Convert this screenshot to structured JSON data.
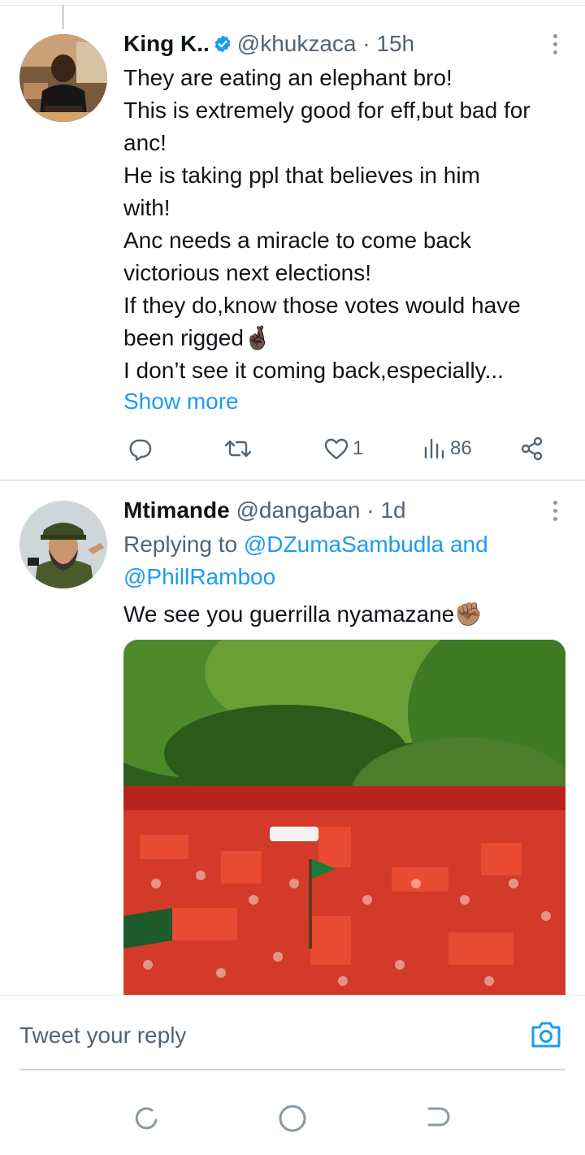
{
  "tweets": [
    {
      "name": "King K..",
      "handle": "@khukzaca",
      "separator": "·",
      "time": "15h",
      "verified": true,
      "lines": [
        "They are eating an elephant bro!",
        "This is extremely good for eff,but bad for",
        "anc!",
        "He is taking ppl that believes in him",
        "with!",
        "Anc needs a miracle to come back",
        "victorious next elections!",
        "If they do,know those votes would have",
        "been rigged🤞🏿",
        "I don’t see it coming back,especially..."
      ],
      "show_more": "Show more",
      "likes": "1",
      "views": "86"
    },
    {
      "name": "Mtimande",
      "handle": "@dangaban",
      "separator": "·",
      "time": "1d",
      "replying_prefix": "Replying to",
      "reply_mention_1": "@DZumaSambudla",
      "reply_and": "and",
      "reply_mention_2": "@PhillRamboo",
      "text": "We see you guerrilla nyamazane✊🏽"
    }
  ],
  "composer": {
    "placeholder": "Tweet your reply"
  },
  "colors": {
    "accent": "#1d9bf0",
    "secondary_text": "#536471",
    "primary_text": "#0f1419",
    "divider": "#e6e9eb"
  },
  "icons": {
    "reply": "reply-icon",
    "retweet": "retweet-icon",
    "like": "like-icon",
    "views": "views-icon",
    "share": "share-icon",
    "camera": "camera-icon"
  }
}
